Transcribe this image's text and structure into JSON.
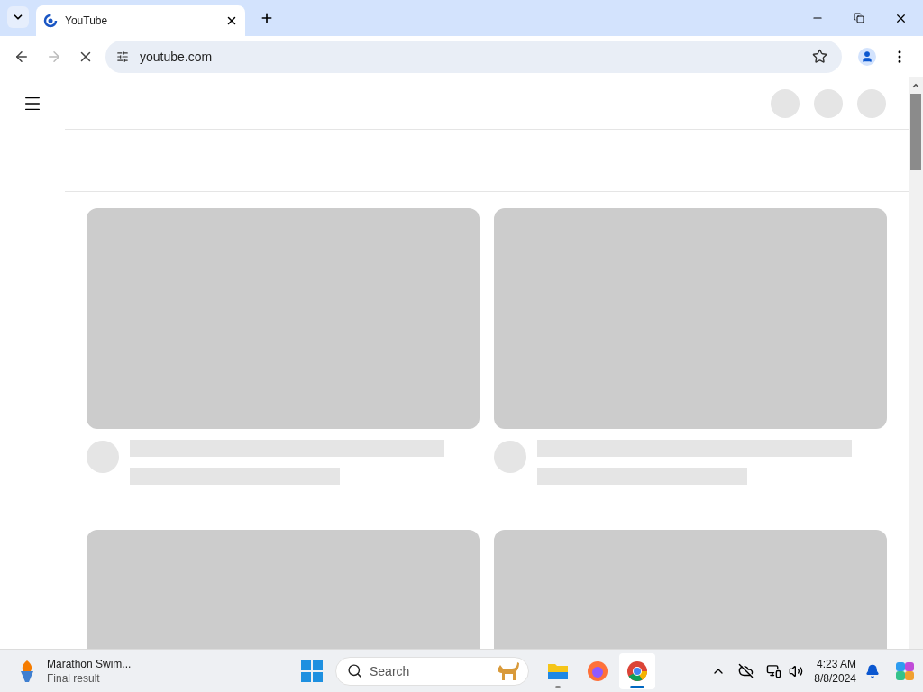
{
  "tabs": [
    {
      "title": "YouTube",
      "selected": true
    }
  ],
  "toolbar": {
    "url": "youtube.com",
    "loading": true
  },
  "taskbar": {
    "widget": {
      "title": "Marathon Swim...",
      "subtitle": "Final result"
    },
    "search": {
      "placeholder": "Search"
    },
    "apps": [
      {
        "kind": "files",
        "running": true,
        "active": false
      },
      {
        "kind": "firefox",
        "running": false,
        "active": false
      },
      {
        "kind": "chrome",
        "running": true,
        "active": true
      }
    ],
    "clock": {
      "time": "4:23 AM",
      "date": "8/8/2024"
    }
  }
}
